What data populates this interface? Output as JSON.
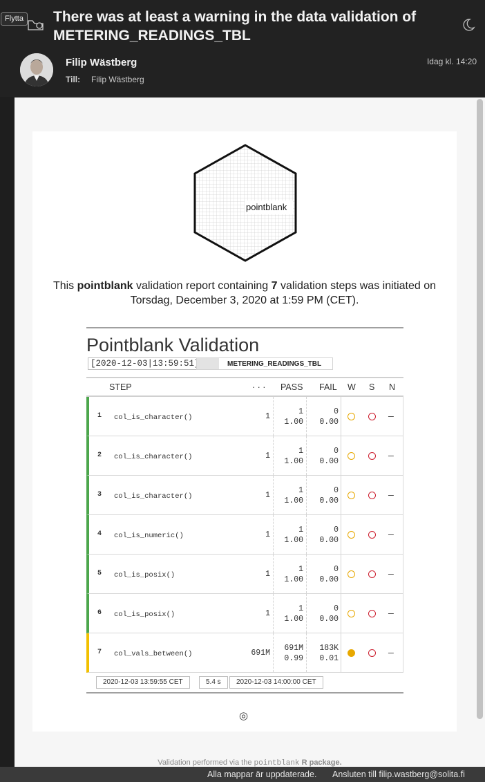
{
  "toolbar": {
    "move_label": "Flytta"
  },
  "email": {
    "subject": "There was at least a warning in the data validation of METERING_READINGS_TBL",
    "sender": "Filip Wästberg",
    "to_label": "Till:",
    "to_value": "Filip Wästberg",
    "date": "Idag kl. 14:20"
  },
  "report": {
    "logo_text": "pointblank",
    "intro_prefix": "This",
    "intro_brand": "pointblank",
    "intro_mid": "validation report containing",
    "intro_count": "7",
    "intro_suffix": "validation steps was initiated on Torsdag, December 3, 2020 at 1:59 PM (CET).",
    "title": "Pointblank Validation",
    "timestamp": "[2020-12-03|13:59:51]",
    "table_name": "METERING_READINGS_TBL",
    "headers": {
      "step": "STEP",
      "units": "· · ·",
      "pass": "PASS",
      "fail": "FAIL",
      "w": "W",
      "s": "S",
      "n": "N"
    },
    "steps": [
      {
        "num": "1",
        "fn": "col_is_character()",
        "units": "1",
        "pass_n": "1",
        "pass_f": "1.00",
        "fail_n": "0",
        "fail_f": "0.00",
        "n": "—"
      },
      {
        "num": "2",
        "fn": "col_is_character()",
        "units": "1",
        "pass_n": "1",
        "pass_f": "1.00",
        "fail_n": "0",
        "fail_f": "0.00",
        "n": "—"
      },
      {
        "num": "3",
        "fn": "col_is_character()",
        "units": "1",
        "pass_n": "1",
        "pass_f": "1.00",
        "fail_n": "0",
        "fail_f": "0.00",
        "n": "—"
      },
      {
        "num": "4",
        "fn": "col_is_numeric()",
        "units": "1",
        "pass_n": "1",
        "pass_f": "1.00",
        "fail_n": "0",
        "fail_f": "0.00",
        "n": "—"
      },
      {
        "num": "5",
        "fn": "col_is_posix()",
        "units": "1",
        "pass_n": "1",
        "pass_f": "1.00",
        "fail_n": "0",
        "fail_f": "0.00",
        "n": "—"
      },
      {
        "num": "6",
        "fn": "col_is_posix()",
        "units": "1",
        "pass_n": "1",
        "pass_f": "1.00",
        "fail_n": "0",
        "fail_f": "0.00",
        "n": "—"
      },
      {
        "num": "7",
        "fn": "col_vals_between()",
        "units": "691M",
        "pass_n": "691M",
        "pass_f": "0.99",
        "fail_n": "183K",
        "fail_f": "0.01",
        "n": "—"
      }
    ],
    "footer": {
      "start": "2020-12-03 13:59:55 CET",
      "duration": "5.4 s",
      "end": "2020-12-03 14:00:00 CET"
    },
    "target_symbol": "◎",
    "via_prefix": "Validation performed via the",
    "via_pkg": "pointblank",
    "via_suffix": "R package."
  },
  "statusbar": {
    "left": "Alla mappar är uppdaterade.",
    "right": "Ansluten till filip.wastberg@solita.fi"
  },
  "colors": {
    "pass_bar": "#4ca64c",
    "warn_bar": "#f2c000",
    "warn_circle": "#e8a800",
    "stop_circle": "#cc1e2e"
  }
}
